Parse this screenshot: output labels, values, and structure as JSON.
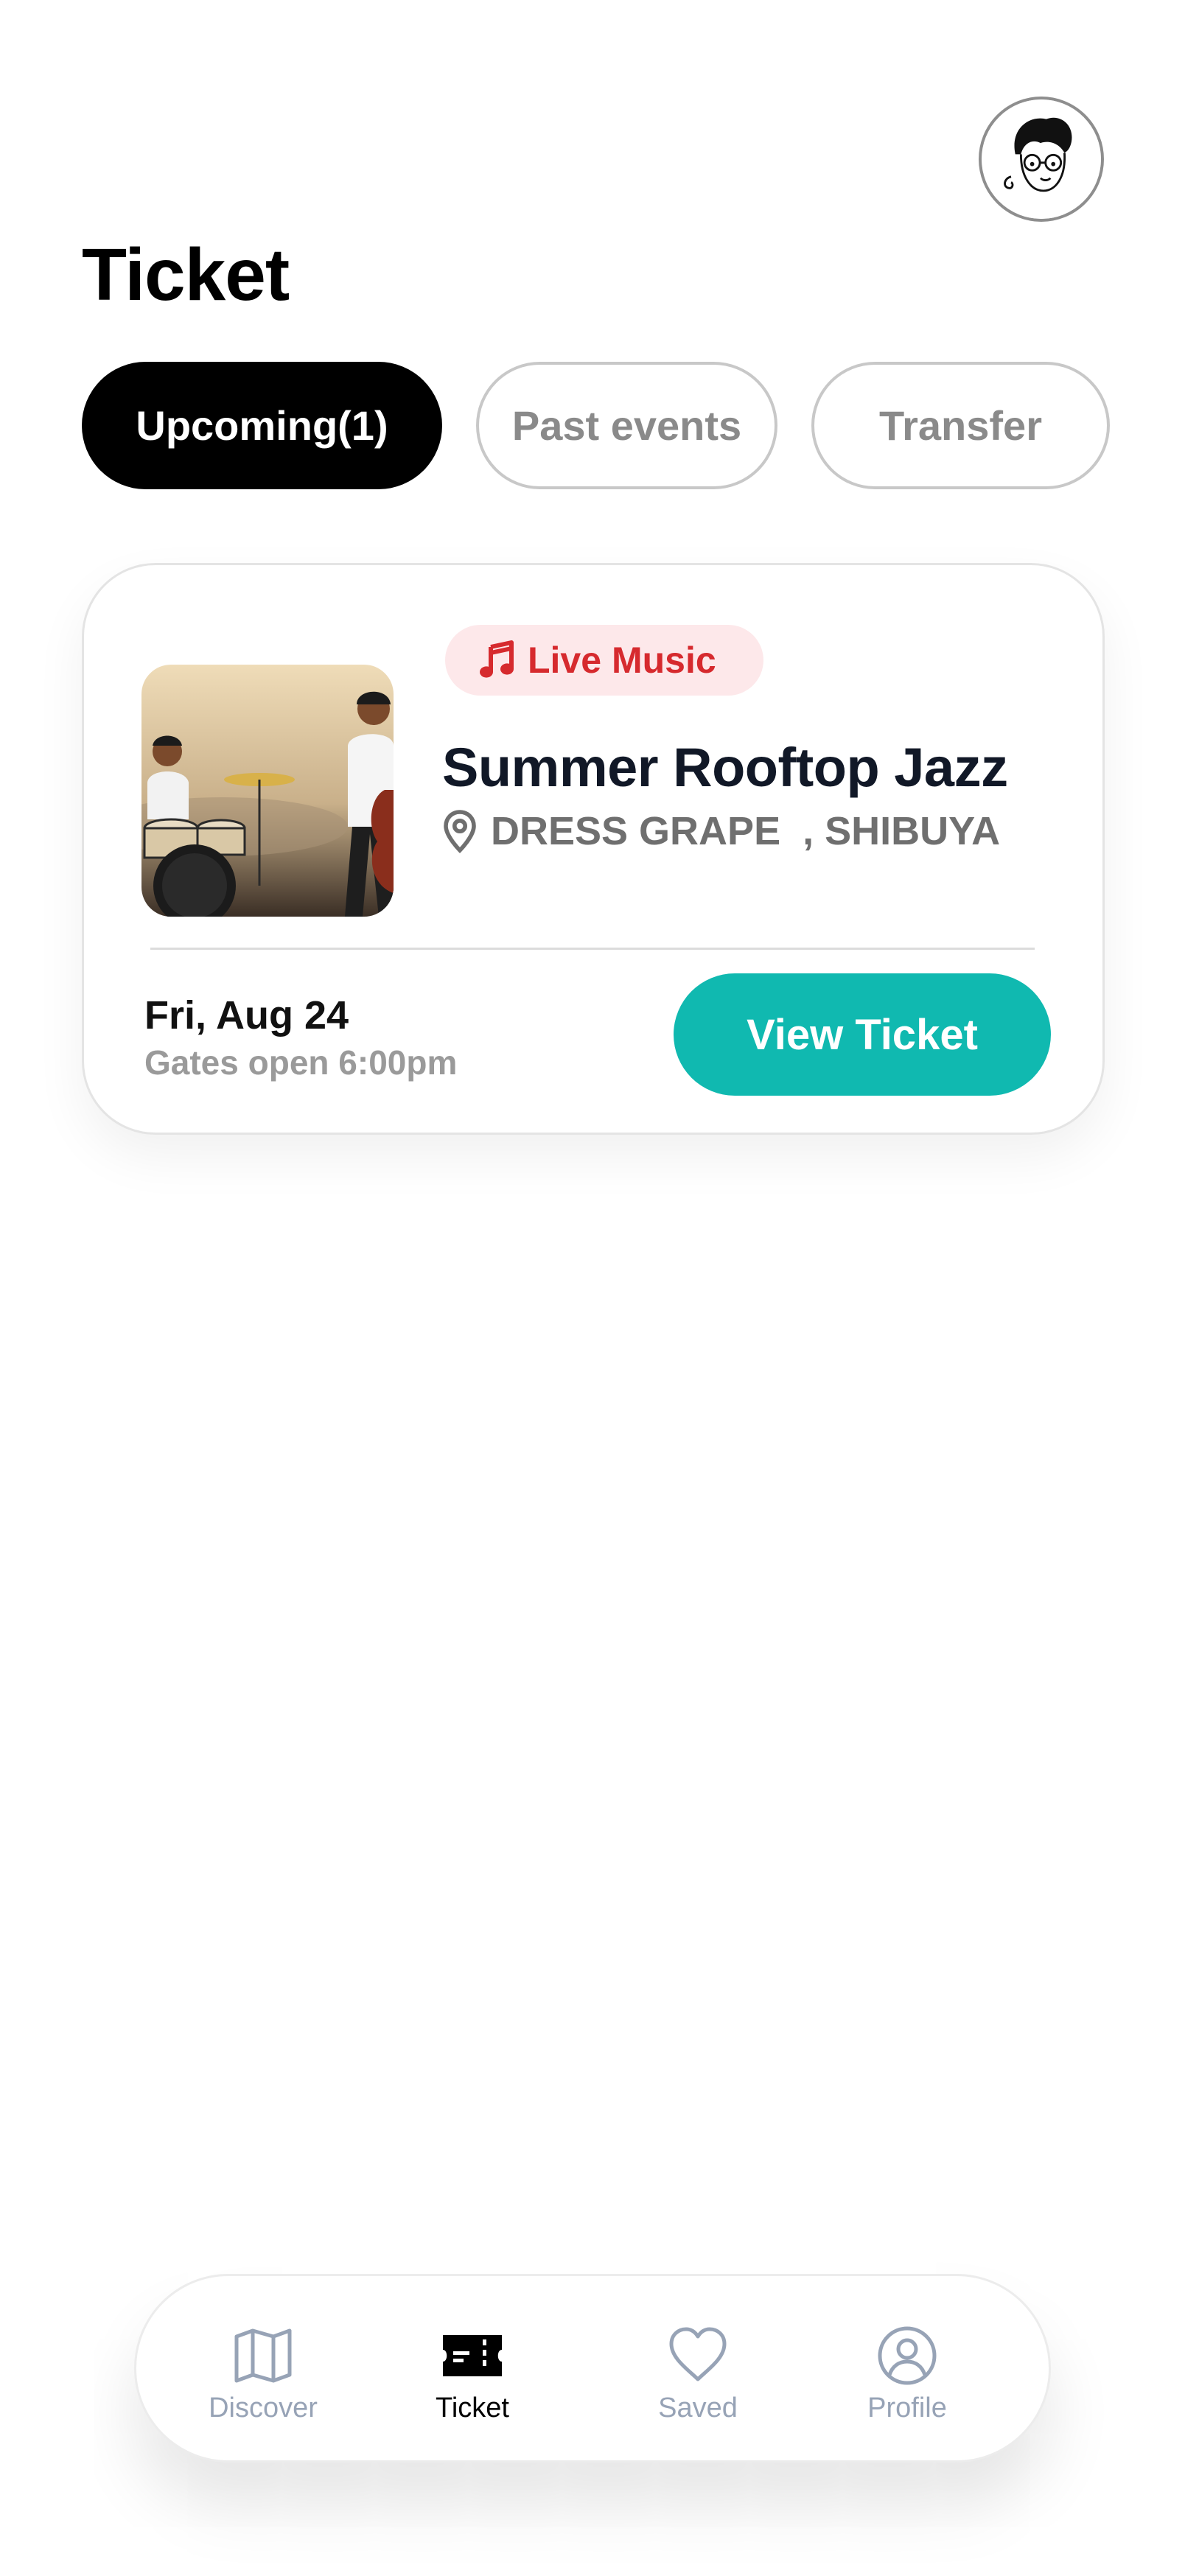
{
  "page": {
    "title": "Ticket"
  },
  "avatar": {
    "icon": "user-avatar-icon"
  },
  "tabs": [
    {
      "label": "Upcoming(1)",
      "active": true
    },
    {
      "label": "Past events",
      "active": false
    },
    {
      "label": "Transfer",
      "active": false
    }
  ],
  "tickets": [
    {
      "category": {
        "label": "Live Music",
        "icon": "music-note-icon",
        "color": "#d62a2e",
        "background": "#fde8ea"
      },
      "title": "Summer Rooftop Jazz",
      "venue": "DRESS GRAPE  , SHIBUYA",
      "venue_icon": "location-pin-icon",
      "date": "Fri, Aug 24",
      "gates": "Gates open 6:00pm",
      "action_label": "View Ticket",
      "action_color": "#10b9b0"
    }
  ],
  "bottom_nav": {
    "items": [
      {
        "label": "Discover",
        "icon": "map-icon",
        "active": false
      },
      {
        "label": "Ticket",
        "icon": "ticket-icon",
        "active": true
      },
      {
        "label": "Saved",
        "icon": "heart-icon",
        "active": false
      },
      {
        "label": "Profile",
        "icon": "profile-icon",
        "active": false
      }
    ]
  },
  "colors": {
    "accent": "#10b9b0",
    "nav_inactive": "#97a3b6",
    "text_primary": "#111827"
  }
}
